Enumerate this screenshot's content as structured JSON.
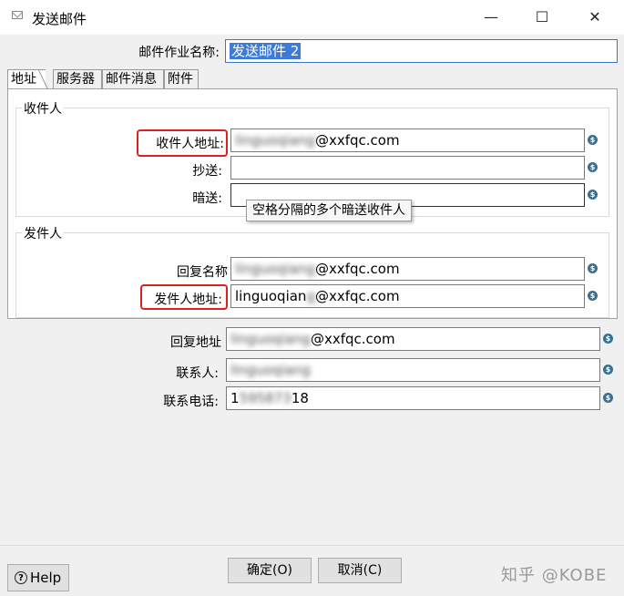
{
  "window": {
    "title": "发送邮件",
    "minimize": "—",
    "maximize": "☐",
    "close": "✕"
  },
  "job_name": {
    "label": "邮件作业名称:",
    "value": "发送邮件 2"
  },
  "tabs": [
    {
      "label": "地址",
      "active": true
    },
    {
      "label": "服务器",
      "active": false
    },
    {
      "label": "邮件消息",
      "active": false
    },
    {
      "label": "附件",
      "active": false
    }
  ],
  "recipient_group": {
    "title": "收件人",
    "address_label": "收件人地址:",
    "address_value_hidden": "linguoqiang",
    "address_value_visible": "@xxfqc.com",
    "cc_label": "抄送:",
    "cc_value": "",
    "bcc_label": "暗送:",
    "bcc_value": "",
    "bcc_tooltip": "空格分隔的多个暗送收件人"
  },
  "sender_group": {
    "title": "发件人",
    "reply_name_label": "回复名称",
    "reply_name_hidden": "linguoqiang",
    "reply_name_visible": "@xxfqc.com",
    "sender_address_label": "发件人地址:",
    "sender_address_visible_prefix": "linguoqian",
    "sender_address_hidden": "g",
    "sender_address_visible": "@xxfqc.com"
  },
  "outer_fields": {
    "reply_address_label": "回复地址",
    "reply_address_hidden": "linguoqiang",
    "reply_address_visible": "@xxfqc.com",
    "contact_label": "联系人:",
    "contact_hidden": "linguoqiang",
    "phone_label": "联系电话:",
    "phone_prefix": "1",
    "phone_hidden": "595873",
    "phone_visible": "18"
  },
  "variable_icon": "$",
  "buttons": {
    "ok": "确定(O)",
    "cancel": "取消(C)",
    "help": "Help",
    "help_icon": "?"
  },
  "watermark": "知乎 @KOBE",
  "colors": {
    "highlight": "#e02020",
    "selection": "#3d7bd6"
  }
}
